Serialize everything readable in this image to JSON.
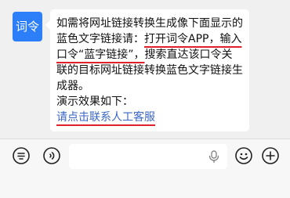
{
  "avatar": {
    "label": "词令",
    "color": "#2d7ff9"
  },
  "message": {
    "line1": "如需将网址链接转换生成像下面显示的蓝色文字链接请：",
    "step1": "打开词令APP，",
    "step2": "输入口令“蓝字链接”，",
    "line2": "搜索直达该口令关联的目标网址链接转换蓝色文字链接生成器。",
    "demo_label": "演示效果如下：",
    "demo_link": "请点击联系人工客服"
  },
  "colors": {
    "link": "#3a66c4",
    "underline_marker": "#e0202a",
    "bubble_bg": "#ffffff",
    "chat_bg": "#f0f0f0"
  },
  "toolbar": {
    "left_icon": "keyboard-list-icon",
    "voice_icon": "voice-toggle-icon",
    "input_value": "",
    "mic_icon": "microphone-icon",
    "emoji_icon": "emoji-icon",
    "plus_icon": "plus-icon"
  }
}
